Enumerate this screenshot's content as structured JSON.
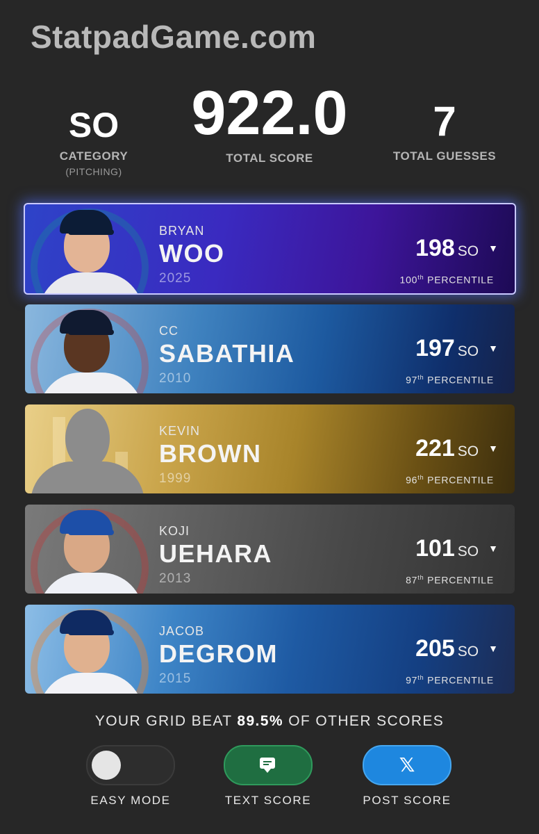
{
  "site": {
    "title": "StatpadGame.com"
  },
  "stats": {
    "category": {
      "value": "SO",
      "label": "CATEGORY",
      "sub": "(PITCHING)"
    },
    "score": {
      "value": "922.0",
      "label": "TOTAL SCORE"
    },
    "guesses": {
      "value": "7",
      "label": "TOTAL GUESSES"
    }
  },
  "players": [
    {
      "first": "BRYAN",
      "last": "WOO",
      "year": "2025",
      "score": "198",
      "unit": "SO",
      "pct_num": "100",
      "pct_suffix": "th",
      "pct_label": "PERCENTILE",
      "team": "mariners",
      "color": "#2e43c8"
    },
    {
      "first": "CC",
      "last": "SABATHIA",
      "year": "2010",
      "score": "197",
      "unit": "SO",
      "pct_num": "97",
      "pct_suffix": "th",
      "pct_label": "PERCENTILE",
      "team": "yankees",
      "color": "#3f82bf"
    },
    {
      "first": "KEVIN",
      "last": "BROWN",
      "year": "1999",
      "score": "221",
      "unit": "SO",
      "pct_num": "96",
      "pct_suffix": "th",
      "pct_label": "PERCENTILE",
      "team": "unknown",
      "color": "#c9a44a"
    },
    {
      "first": "KOJI",
      "last": "UEHARA",
      "year": "2013",
      "score": "101",
      "unit": "SO",
      "pct_num": "87",
      "pct_suffix": "th",
      "pct_label": "PERCENTILE",
      "team": "red-sox",
      "color": "#5f5f5f"
    },
    {
      "first": "JACOB",
      "last": "DEGROM",
      "year": "2015",
      "score": "205",
      "unit": "SO",
      "pct_num": "97",
      "pct_suffix": "th",
      "pct_label": "PERCENTILE",
      "team": "mets",
      "color": "#1e5aa3"
    }
  ],
  "summary": {
    "prefix": "YOUR GRID BEAT",
    "value": "89.5%",
    "suffix": "OF OTHER SCORES"
  },
  "controls": {
    "easy_mode": {
      "label": "EASY MODE",
      "on": false
    },
    "text_score": {
      "label": "TEXT SCORE",
      "icon": "chat-icon"
    },
    "post_score": {
      "label": "POST SCORE",
      "icon": "x-logo-icon"
    }
  },
  "caret": "▼"
}
